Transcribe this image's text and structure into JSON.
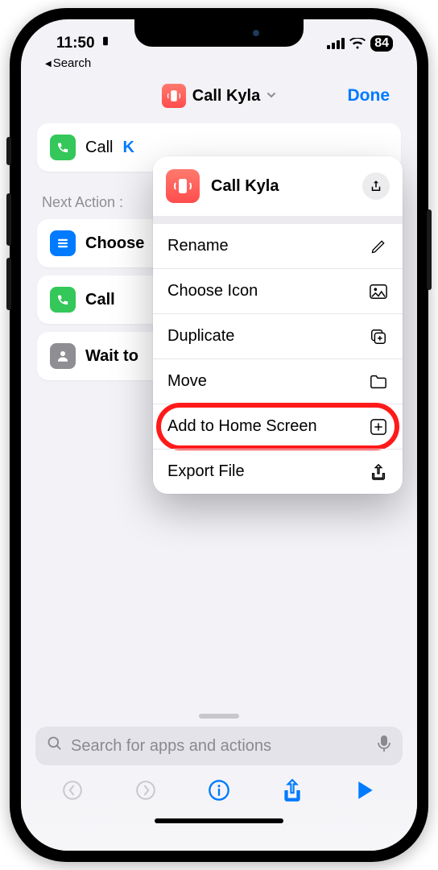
{
  "status": {
    "time": "11:50",
    "battery": "84"
  },
  "backNav": "Search",
  "header": {
    "title": "Call Kyla",
    "done": "Done"
  },
  "mainAction": {
    "verb": "Call",
    "token": "K"
  },
  "sectionLabel": "Next Action :",
  "actions": {
    "choose": "Choose",
    "call": "Call",
    "wait": "Wait to"
  },
  "dropdown": {
    "title": "Call Kyla",
    "rename": "Rename",
    "chooseIcon": "Choose Icon",
    "duplicate": "Duplicate",
    "move": "Move",
    "addHome": "Add to Home Screen",
    "exportFile": "Export File"
  },
  "search": {
    "placeholder": "Search for apps and actions"
  }
}
